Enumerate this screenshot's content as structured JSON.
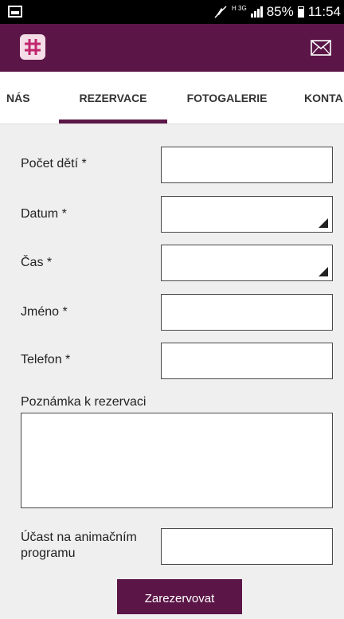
{
  "status_bar": {
    "network_type": "H 3G",
    "battery_percent": "85%",
    "time": "11:54",
    "icons": [
      "image-notification-icon",
      "no-sound-icon",
      "signal-icon",
      "battery-icon"
    ]
  },
  "app_bar": {
    "logo_icon": "grid-logo-icon",
    "mail_icon": "mail-icon",
    "color": "#5b1647"
  },
  "tabs": [
    {
      "label": "NÁS"
    },
    {
      "label": "REZERVACE",
      "active": true
    },
    {
      "label": "FOTOGALERIE"
    },
    {
      "label": "KONTA"
    }
  ],
  "form": {
    "children_count_label": "Počet dětí *",
    "date_label": "Datum *",
    "time_label": "Čas *",
    "name_label": "Jméno *",
    "phone_label": "Telefon *",
    "note_label": "Poznámka k rezervaci",
    "animation_label": "Účast na animačním programu",
    "submit_label": "Zarezervovat",
    "children_count_value": "",
    "date_value": "",
    "time_value": "",
    "name_value": "",
    "phone_value": "",
    "note_value": "",
    "animation_value": ""
  }
}
